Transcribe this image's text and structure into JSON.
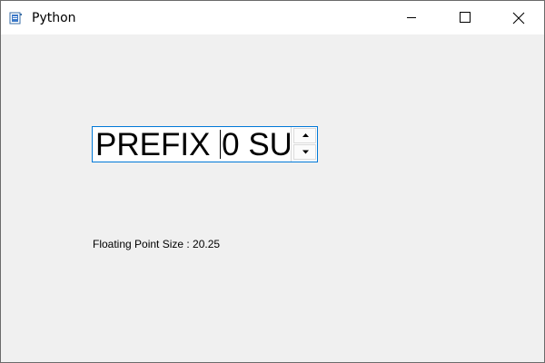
{
  "window": {
    "title": "Python",
    "app_icon": "python-app-icon",
    "controls": {
      "minimize_icon": "minimize-icon",
      "maximize_icon": "maximize-icon",
      "close_icon": "close-icon"
    }
  },
  "spinbox": {
    "prefix": "PREFIX ",
    "value": "0",
    "suffix": " SUFFIX",
    "up_icon": "arrow-up-icon",
    "down_icon": "arrow-down-icon",
    "accent_color": "#0078d7"
  },
  "info": {
    "label": "Floating Point Size : 20.25"
  },
  "colors": {
    "window_bg": "#f0f0f0",
    "titlebar_bg": "#ffffff",
    "focus_border": "#0078d7"
  }
}
